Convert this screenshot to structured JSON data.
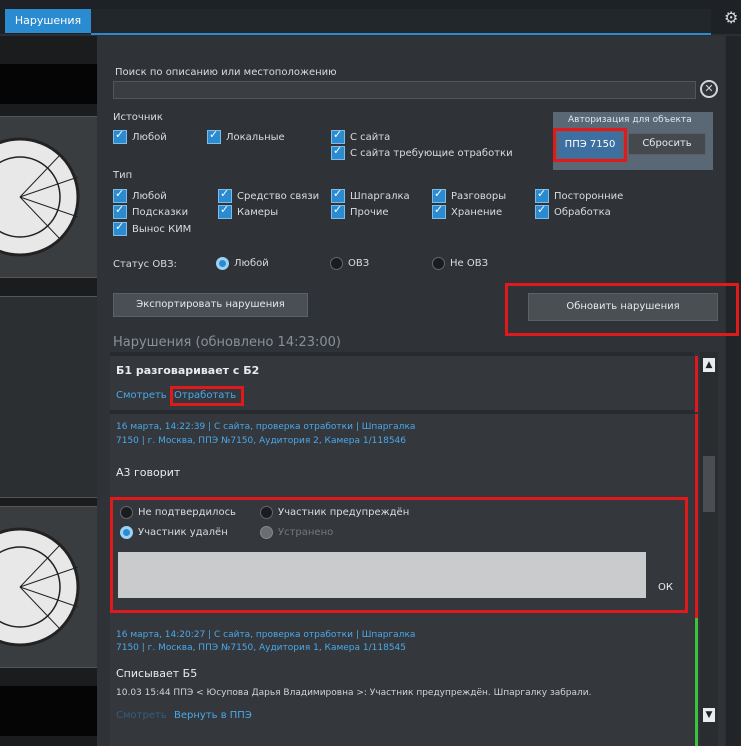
{
  "tabs": {
    "active": "Нарушения"
  },
  "search": {
    "label": "Поиск по описанию или местоположению",
    "value": ""
  },
  "sources": {
    "label": "Источник",
    "items": [
      "Любой",
      "Локальные",
      "С сайта",
      "С сайта требующие отработки"
    ]
  },
  "auth": {
    "title": "Авторизация для объекта",
    "object": "ППЭ 7150",
    "reset": "Сбросить"
  },
  "types": {
    "label": "Тип",
    "items": [
      "Любой",
      "Средство связи",
      "Шпаргалка",
      "Разговоры",
      "Посторонние",
      "Подсказки",
      "Камеры",
      "Прочие",
      "Хранение",
      "Обработка",
      "Вынос КИМ"
    ]
  },
  "status": {
    "label": "Статус ОВЗ:",
    "options": [
      "Любой",
      "ОВЗ",
      "Не ОВЗ"
    ],
    "selected": "Любой"
  },
  "actions": {
    "export": "Экспортировать нарушения",
    "refresh": "Обновить нарушения"
  },
  "list": {
    "heading": "Нарушения",
    "updated": "(обновлено 14:23:00)",
    "items": [
      {
        "title": "Б1 разговаривает с Б2",
        "links": [
          "Смотреть",
          "Отработать"
        ]
      },
      {
        "meta": "16 марта, 14:22:39 | С сайта, проверка отработки | Шпаргалка",
        "location": "7150 | г. Москва, ППЭ №7150, Аудитория 2, Камера 1/118546",
        "title": "А3 говорит",
        "resolution": {
          "options": [
            "Не подтвердилось",
            "Участник предупреждён",
            "Участник удалён",
            "Устранено"
          ],
          "selected": "Участник удалён",
          "ok": "ОК"
        }
      },
      {
        "meta": "16 марта, 14:20:27 | С сайта, проверка отработки | Шпаргалка",
        "location": "7150 | г. Москва, ППЭ №7150, Аудитория 1, Камера 1/118545",
        "title": "Списывает Б5",
        "note": "10.03 15:44 ППЭ < Юсупова Дарья Владимировна >: Участник предупреждён. Шпаргалку забрали.",
        "links": [
          "Смотреть",
          "Вернуть в ППЭ"
        ]
      }
    ]
  },
  "colors": {
    "accent": "#2a8bd0",
    "highlight": "#e0191c",
    "status_ok": "#3cc23c"
  }
}
